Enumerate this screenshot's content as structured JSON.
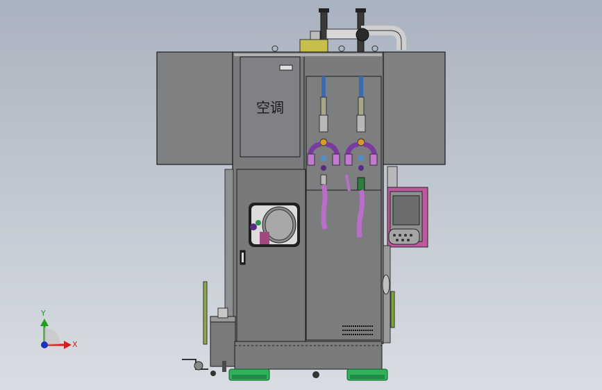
{
  "panel": {
    "ac_label": "空调",
    "nameplate": "",
    "triad": {
      "x_label": "X",
      "y_label": "Y"
    }
  },
  "colors": {
    "body": "#7d7e80",
    "outline": "#1b1b1b",
    "hose": "#b96ec8",
    "pad": "#2fb25a",
    "magenta_frame": "#c0589f",
    "axis_x": "#d02020",
    "axis_y": "#1fa01f",
    "axis_z": "#2030c0"
  }
}
